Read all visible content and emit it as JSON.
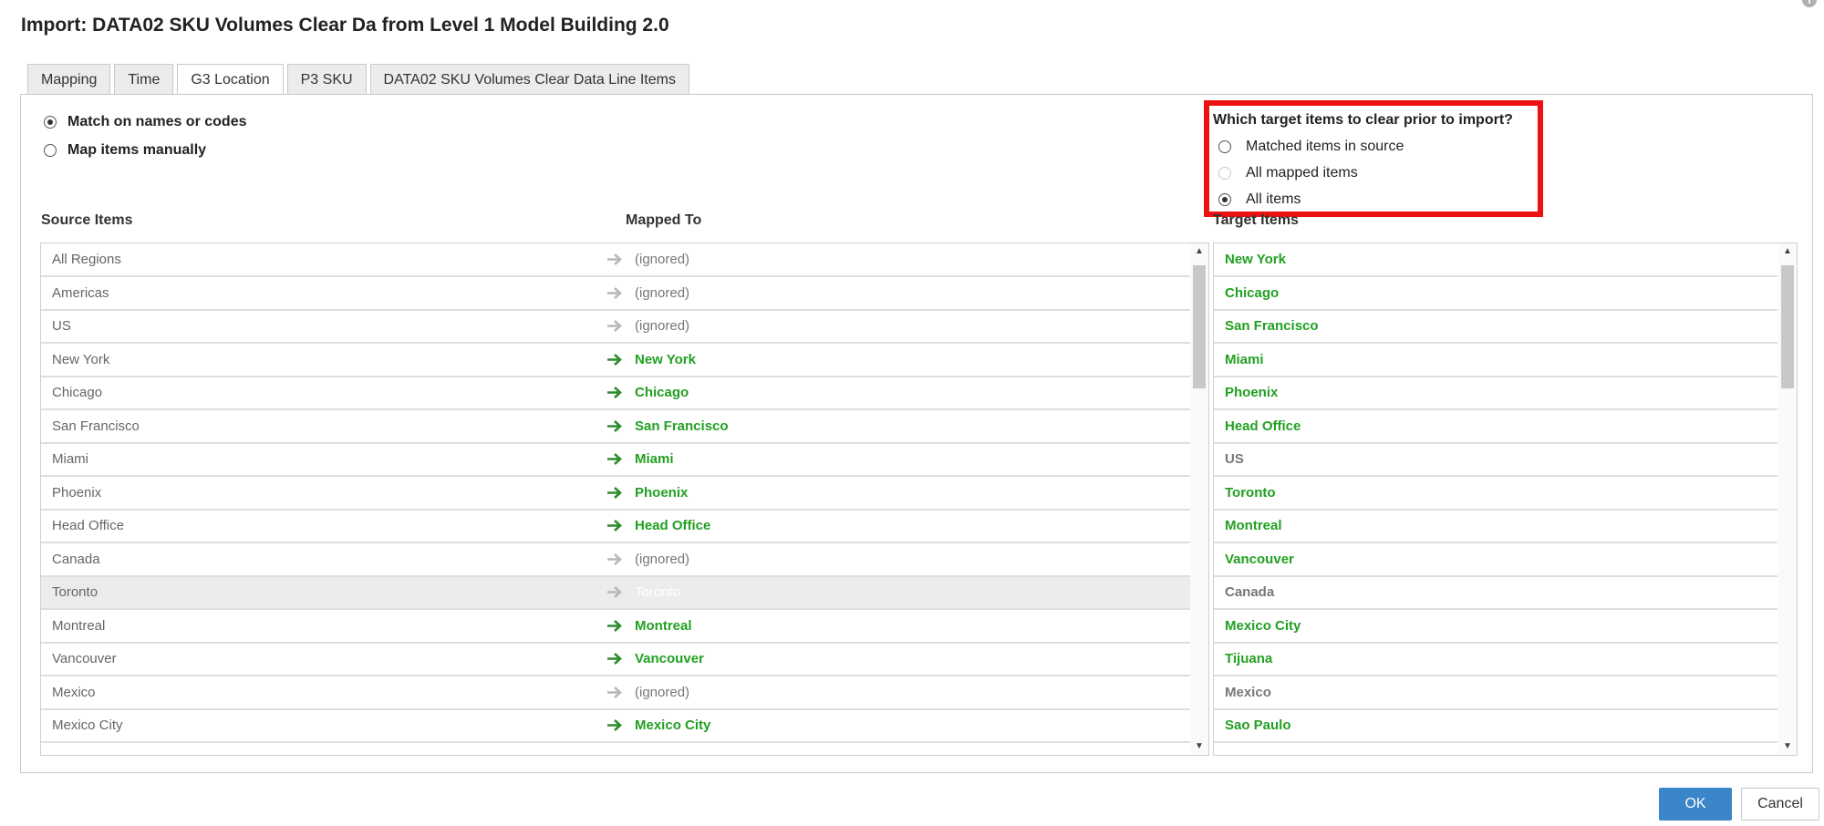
{
  "dialog": {
    "title": "Import: DATA02 SKU Volumes Clear Da from Level 1 Model Building 2.0",
    "info_icon": "info-icon"
  },
  "tabs": [
    {
      "label": "Mapping",
      "active": false
    },
    {
      "label": "Time",
      "active": false
    },
    {
      "label": "G3 Location",
      "active": true
    },
    {
      "label": "P3 SKU",
      "active": false
    },
    {
      "label": "DATA02 SKU Volumes Clear Data Line Items",
      "active": false
    }
  ],
  "match_options": {
    "option1": "Match on names or codes",
    "option2": "Map items manually",
    "selected": "option1"
  },
  "clear_options": {
    "title": "Which target items to clear prior to import?",
    "option1": "Matched items in source",
    "option2": "All mapped items",
    "option3": "All items",
    "selected": "option3"
  },
  "columns": {
    "source": "Source Items",
    "mapped": "Mapped To",
    "target": "Target Items"
  },
  "rows": [
    {
      "source": "All Regions",
      "mapped": "(ignored)",
      "status": "ignored"
    },
    {
      "source": "Americas",
      "mapped": "(ignored)",
      "status": "ignored"
    },
    {
      "source": "US",
      "mapped": "(ignored)",
      "status": "ignored"
    },
    {
      "source": "New York",
      "mapped": "New York",
      "status": "mapped"
    },
    {
      "source": "Chicago",
      "mapped": "Chicago",
      "status": "mapped"
    },
    {
      "source": "San Francisco",
      "mapped": "San Francisco",
      "status": "mapped"
    },
    {
      "source": "Miami",
      "mapped": "Miami",
      "status": "mapped"
    },
    {
      "source": "Phoenix",
      "mapped": "Phoenix",
      "status": "mapped"
    },
    {
      "source": "Head Office",
      "mapped": "Head Office",
      "status": "mapped"
    },
    {
      "source": "Canada",
      "mapped": "(ignored)",
      "status": "ignored"
    },
    {
      "source": "Toronto",
      "mapped": "Toronto",
      "status": "selected"
    },
    {
      "source": "Montreal",
      "mapped": "Montreal",
      "status": "mapped"
    },
    {
      "source": "Vancouver",
      "mapped": "Vancouver",
      "status": "mapped"
    },
    {
      "source": "Mexico",
      "mapped": "(ignored)",
      "status": "ignored"
    },
    {
      "source": "Mexico City",
      "mapped": "Mexico City",
      "status": "mapped"
    }
  ],
  "targets": [
    {
      "name": "New York",
      "color": "green"
    },
    {
      "name": "Chicago",
      "color": "green"
    },
    {
      "name": "San Francisco",
      "color": "green"
    },
    {
      "name": "Miami",
      "color": "green"
    },
    {
      "name": "Phoenix",
      "color": "green"
    },
    {
      "name": "Head Office",
      "color": "green"
    },
    {
      "name": "US",
      "color": "gray"
    },
    {
      "name": "Toronto",
      "color": "green"
    },
    {
      "name": "Montreal",
      "color": "green"
    },
    {
      "name": "Vancouver",
      "color": "green"
    },
    {
      "name": "Canada",
      "color": "gray"
    },
    {
      "name": "Mexico City",
      "color": "green"
    },
    {
      "name": "Tijuana",
      "color": "green"
    },
    {
      "name": "Mexico",
      "color": "gray"
    },
    {
      "name": "Sao Paulo",
      "color": "green"
    }
  ],
  "buttons": {
    "ok": "OK",
    "cancel": "Cancel"
  },
  "colors": {
    "mapped_green": "#22a022",
    "ignored_gray": "#777777",
    "highlight_red": "#ee1111",
    "ok_blue": "#3a86c8"
  },
  "icons": {
    "arrow": "right-arrow-icon",
    "scroll_up": "scroll-up-icon",
    "scroll_down": "scroll-down-icon"
  }
}
